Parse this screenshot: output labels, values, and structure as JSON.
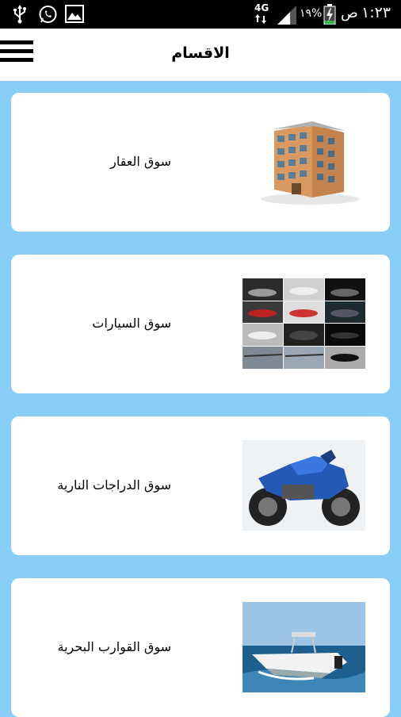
{
  "status_bar": {
    "network": "4G",
    "battery": "١٩%",
    "period": "ص",
    "time": "١:٢٣"
  },
  "app_bar": {
    "title": "الاقسام"
  },
  "categories": [
    {
      "label": "سوق العقار",
      "icon": "building-image"
    },
    {
      "label": "سوق السيارات",
      "icon": "cars-collage-image"
    },
    {
      "label": "سوق الدراجات النارية",
      "icon": "motorcycle-image"
    },
    {
      "label": "سوق القوارب البحرية",
      "icon": "boat-image"
    }
  ],
  "colors": {
    "background": "#87cdf5",
    "card": "#ffffff",
    "status_bar": "#000000",
    "battery_fill": "#33b54a"
  }
}
